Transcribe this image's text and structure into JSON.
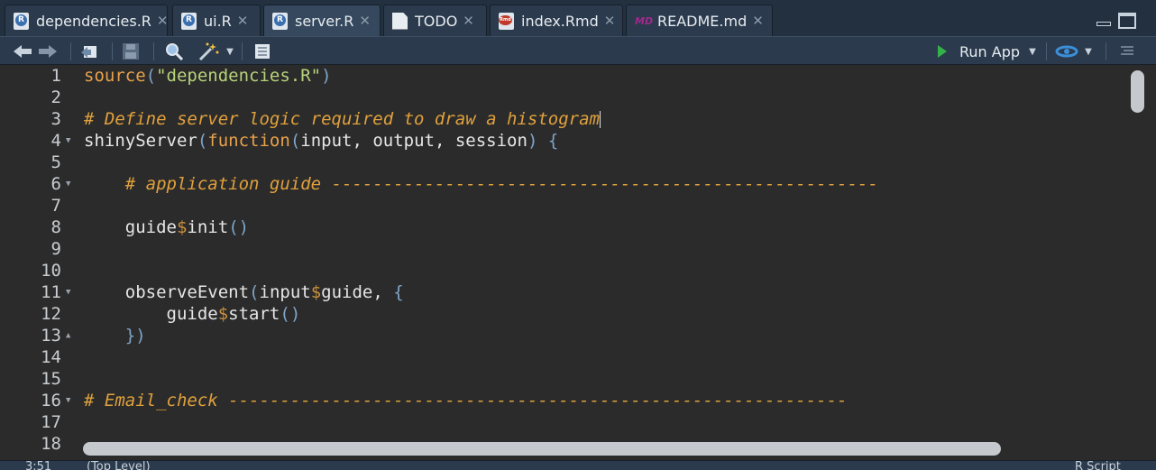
{
  "tabs": [
    {
      "label": "dependencies.R",
      "icon": "r-file-icon",
      "active": false
    },
    {
      "label": "ui.R",
      "icon": "r-file-icon",
      "active": false
    },
    {
      "label": "server.R",
      "icon": "r-file-icon",
      "active": true
    },
    {
      "label": "TODO",
      "icon": "text-file-icon",
      "active": false
    },
    {
      "label": "index.Rmd",
      "icon": "rmd-file-icon",
      "active": false
    },
    {
      "label": "README.md",
      "icon": "md-file-icon",
      "active": false
    }
  ],
  "close_glyph": "✕",
  "toolbar": {
    "run_app_label": "Run App"
  },
  "editor": {
    "lines": [
      {
        "num": "1"
      },
      {
        "num": "2"
      },
      {
        "num": "3"
      },
      {
        "num": "4"
      },
      {
        "num": "5"
      },
      {
        "num": "6"
      },
      {
        "num": "7"
      },
      {
        "num": "8"
      },
      {
        "num": "9"
      },
      {
        "num": "10"
      },
      {
        "num": "11"
      },
      {
        "num": "12"
      },
      {
        "num": "13"
      },
      {
        "num": "14"
      },
      {
        "num": "15"
      },
      {
        "num": "16"
      },
      {
        "num": "17"
      },
      {
        "num": "18"
      }
    ],
    "code": {
      "l1_fn": "source",
      "l1_str": "\"dependencies.R\"",
      "l3_comment": "# Define server logic required to draw a histogram",
      "l4_fn": "shinyServer",
      "l4_kw": "function",
      "l4_args": "input, output, session",
      "l6_comment": "# application guide -----------------------------------------------------",
      "l8_obj": "guide",
      "l8_fn": "init",
      "l11_fn": "observeEvent",
      "l11_obj": "input",
      "l11_field": "guide",
      "l12_obj": "guide",
      "l12_fn": "start",
      "l16_comment": "# Email_check ------------------------------------------------------------"
    }
  },
  "status": {
    "position": "3:51",
    "scope": "(Top Level)",
    "filetype": "R Script"
  },
  "colors": {
    "keyword": "#e8a24b",
    "string": "#b8d27a",
    "comment": "#e0a13c",
    "run_icon": "#33b24a"
  }
}
